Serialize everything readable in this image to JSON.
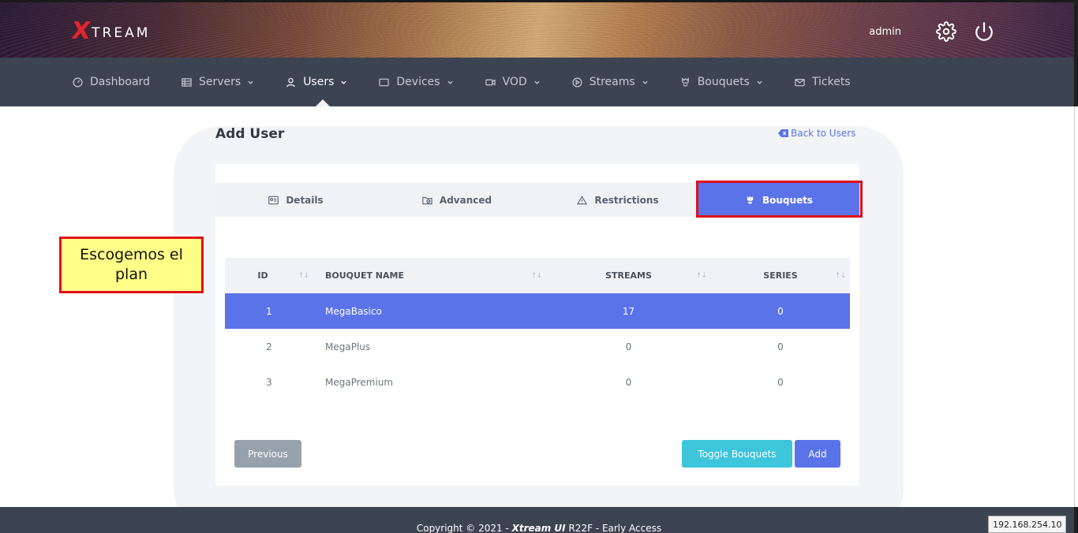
{
  "brand": {
    "logo_x": "X",
    "logo_rest": "TREAM"
  },
  "header": {
    "username": "admin",
    "settings_icon": "gear-icon",
    "logout_icon": "power-icon"
  },
  "nav": {
    "items": [
      {
        "label": "Dashboard",
        "icon": "gauge-icon",
        "has_dropdown": false
      },
      {
        "label": "Servers",
        "icon": "server-icon",
        "has_dropdown": true
      },
      {
        "label": "Users",
        "icon": "user-icon",
        "has_dropdown": true,
        "active": true
      },
      {
        "label": "Devices",
        "icon": "monitor-icon",
        "has_dropdown": true
      },
      {
        "label": "VOD",
        "icon": "video-icon",
        "has_dropdown": true
      },
      {
        "label": "Streams",
        "icon": "play-circle-icon",
        "has_dropdown": true
      },
      {
        "label": "Bouquets",
        "icon": "flower-icon",
        "has_dropdown": true
      },
      {
        "label": "Tickets",
        "icon": "mail-icon",
        "has_dropdown": false
      }
    ]
  },
  "page": {
    "title": "Add User",
    "back_link": "Back to Users"
  },
  "tabs": [
    {
      "label": "Details",
      "icon": "id-card-icon"
    },
    {
      "label": "Advanced",
      "icon": "folder-clock-icon"
    },
    {
      "label": "Restrictions",
      "icon": "warning-icon"
    },
    {
      "label": "Bouquets",
      "icon": "flower-icon",
      "active": true
    }
  ],
  "table": {
    "headers": [
      "ID",
      "BOUQUET NAME",
      "STREAMS",
      "SERIES"
    ],
    "rows": [
      {
        "id": "1",
        "name": "MegaBasico",
        "streams": "17",
        "series": "0",
        "selected": true
      },
      {
        "id": "2",
        "name": "MegaPlus",
        "streams": "0",
        "series": "0",
        "selected": false
      },
      {
        "id": "3",
        "name": "MegaPremium",
        "streams": "0",
        "series": "0",
        "selected": false
      }
    ]
  },
  "buttons": {
    "previous": "Previous",
    "toggle": "Toggle Bouquets",
    "add": "Add"
  },
  "annotation": {
    "callout_text": "Escogemos el plan"
  },
  "footer": {
    "prefix": "Copyright © 2021 - ",
    "brand": "Xtream UI",
    "suffix": " R22F - Early Access"
  },
  "overlay": {
    "ip": "192.168.254.10"
  },
  "colors": {
    "primary": "#5b73e8",
    "info": "#3dc5dc",
    "secondary": "#97a1ac",
    "nav_bg": "#3d4451",
    "highlight_red": "#e0101a",
    "callout_yellow": "#ffff88"
  }
}
